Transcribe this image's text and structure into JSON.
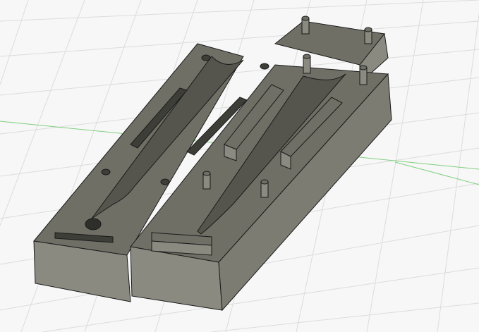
{
  "viewport": {
    "background": "#f7f7f7",
    "grid_color": "#dcdcdc",
    "axis_x_color": "#7fcf7f",
    "axis_y_color": "#7fcf7f",
    "model_colors": {
      "top": "#6f6f66",
      "side": "#8a8a80",
      "dark": "#3e3e38",
      "edge": "#1a1a1a",
      "slot": "#454540"
    }
  },
  "scene": {
    "objects": [
      "left-mold-half",
      "right-mold-half",
      "upper-cap-block"
    ]
  }
}
